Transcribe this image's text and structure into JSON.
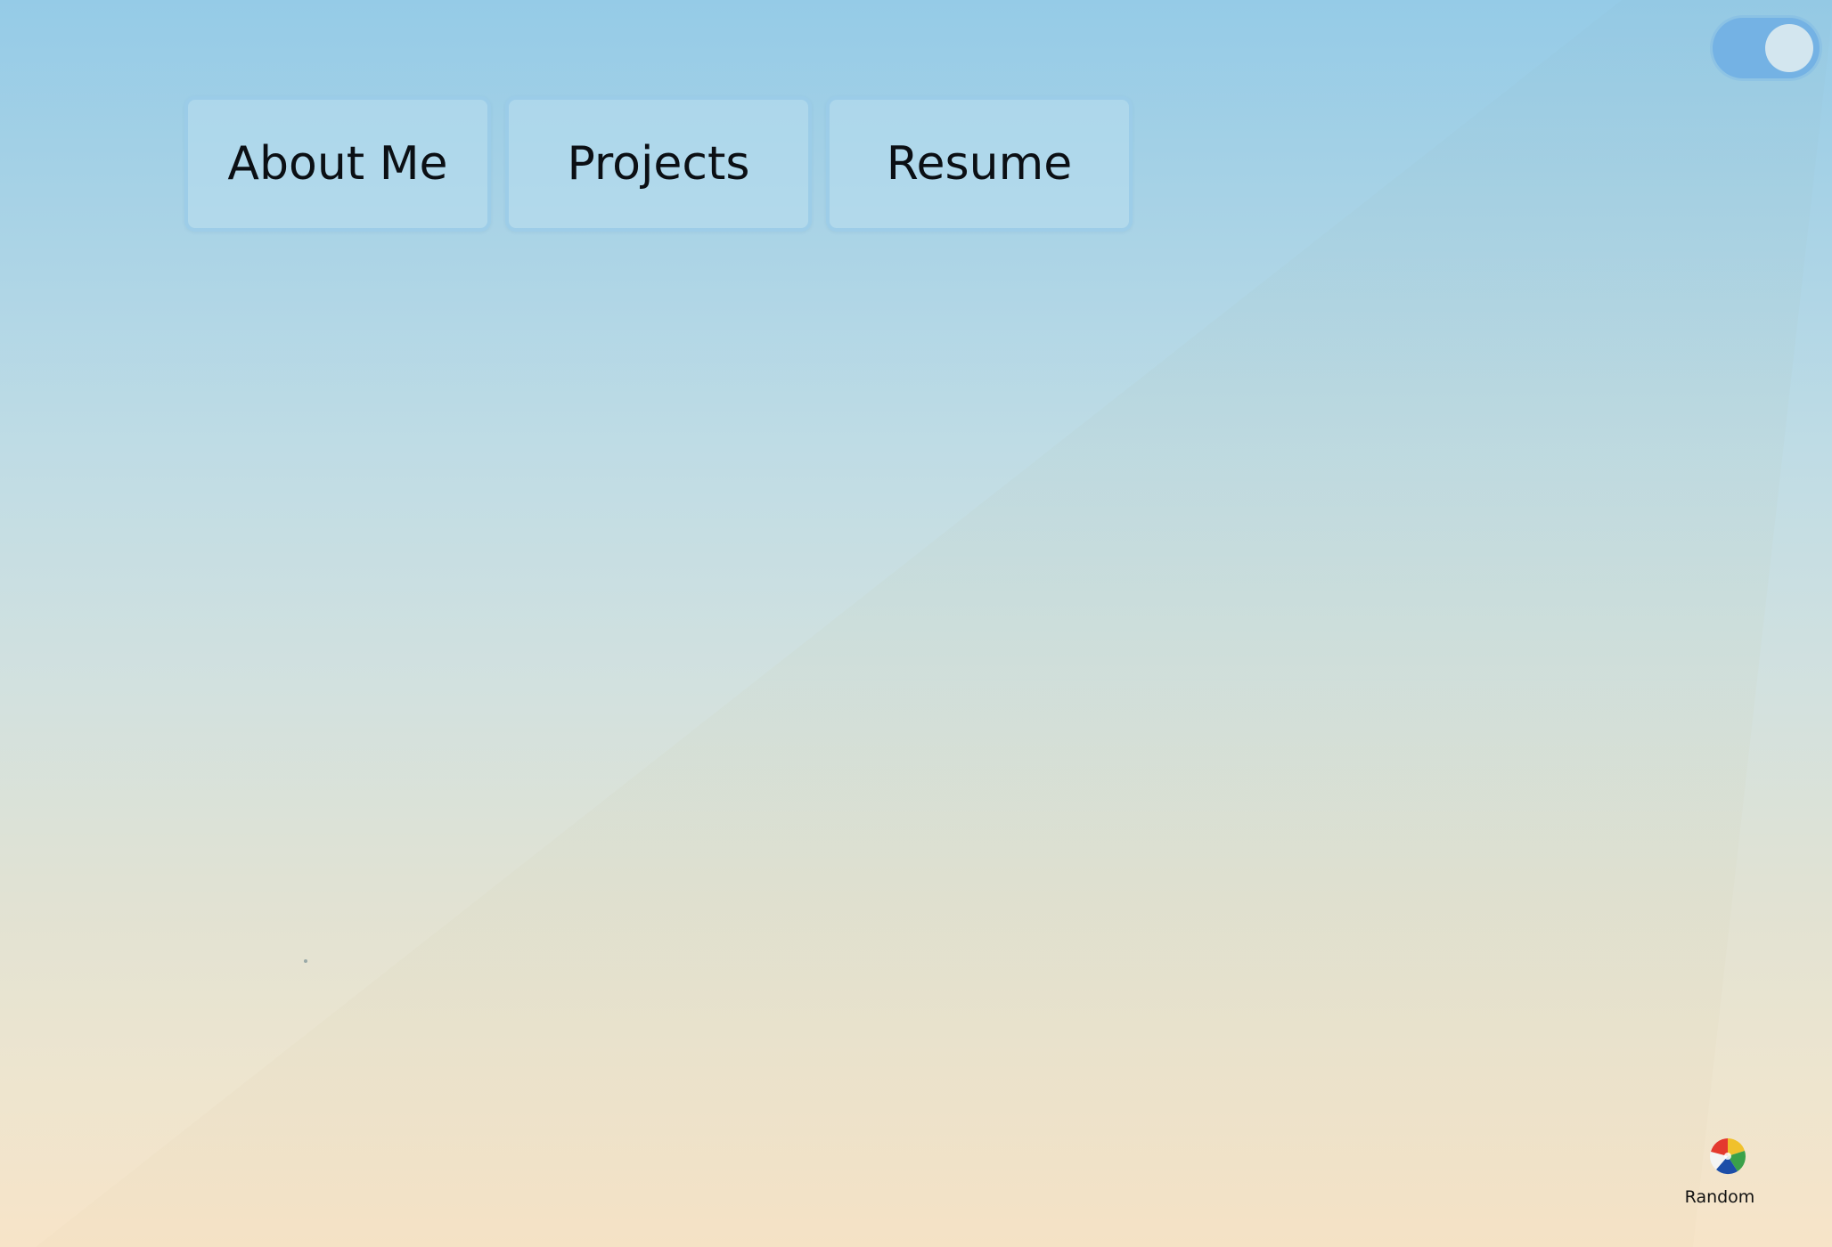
{
  "nav": {
    "items": [
      {
        "label": "About Me"
      },
      {
        "label": "Projects"
      },
      {
        "label": "Resume"
      }
    ]
  },
  "theme_toggle": {
    "state": "on",
    "track_color": "#74b2e4",
    "knob_color": "#d3e6ef",
    "icon": "toggle-switch-icon"
  },
  "random": {
    "label": "Random",
    "icon": "beach-ball-icon"
  },
  "colors": {
    "sky_top": "#95cbe7",
    "sand_bottom": "#f7e4c8",
    "button_text": "#0b0f14"
  }
}
